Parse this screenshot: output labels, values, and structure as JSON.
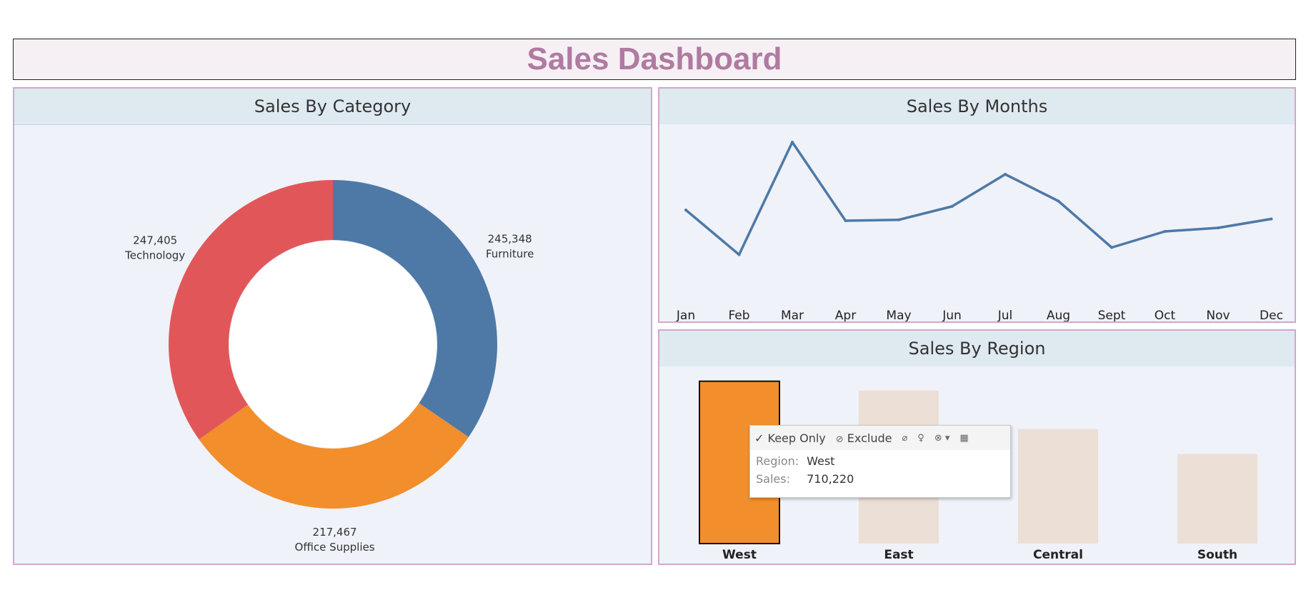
{
  "dashboard": {
    "title": "Sales Dashboard"
  },
  "colors": {
    "title": "#b07aa1",
    "furniture": "#4e79a7",
    "office_supplies": "#f28e2b",
    "technology": "#e15759",
    "line": "#4e79a7",
    "bar_selected": "#f28e2b",
    "bar_dimmed": "#ecdfd6"
  },
  "panels": {
    "category": {
      "title": "Sales By Category"
    },
    "months": {
      "title": "Sales By Months"
    },
    "region": {
      "title": "Sales By Region"
    }
  },
  "tooltip": {
    "keep_only": "Keep Only",
    "exclude": "Exclude",
    "region_key": "Region:",
    "region_value": "West",
    "sales_key": "Sales:",
    "sales_value": "710,220",
    "icons": [
      "check-icon",
      "exclude-icon",
      "paperclip-icon",
      "lightbulb-icon",
      "group-icon",
      "view-data-icon"
    ]
  },
  "chart_data": [
    {
      "type": "pie",
      "subtype": "donut",
      "title": "Sales By Category",
      "slices": [
        {
          "label": "Furniture",
          "value": 245348,
          "value_label": "245,348",
          "color": "#4e79a7"
        },
        {
          "label": "Office Supplies",
          "value": 217467,
          "value_label": "217,467",
          "color": "#f28e2b"
        },
        {
          "label": "Technology",
          "value": 247405,
          "value_label": "247,405",
          "color": "#e15759"
        }
      ]
    },
    {
      "type": "line",
      "title": "Sales By Months",
      "categories": [
        "Jan",
        "Feb",
        "Mar",
        "Apr",
        "May",
        "Jun",
        "Jul",
        "Aug",
        "Sept",
        "Oct",
        "Nov",
        "Dec"
      ],
      "values": [
        54000,
        29000,
        92000,
        48000,
        48500,
        56000,
        74000,
        59000,
        33000,
        42000,
        44000,
        49000
      ],
      "ylim": [
        0,
        100000
      ],
      "grid": false
    },
    {
      "type": "bar",
      "title": "Sales By Region",
      "categories": [
        "West",
        "East",
        "Central",
        "South"
      ],
      "values": [
        710220,
        669518,
        501240,
        391722
      ],
      "selected": "West",
      "ylim": [
        0,
        750000
      ]
    }
  ]
}
